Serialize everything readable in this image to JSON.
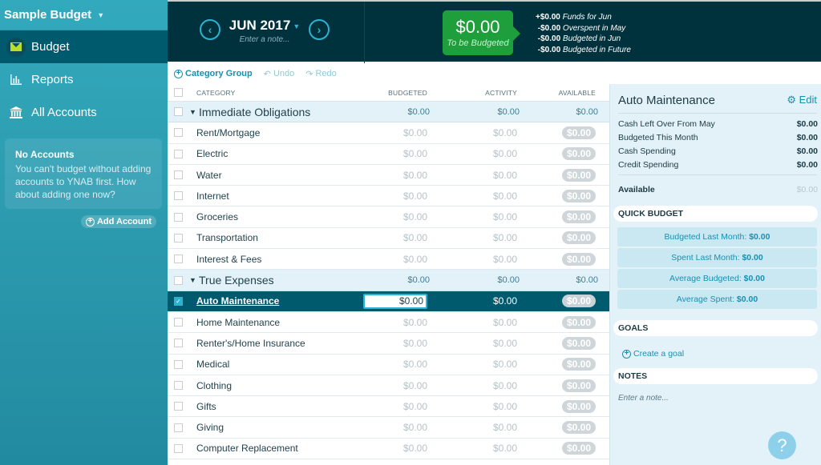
{
  "sidebar": {
    "budget_name": "Sample Budget",
    "nav": [
      {
        "label": "Budget",
        "icon": "envelope-icon",
        "active": true
      },
      {
        "label": "Reports",
        "icon": "bar-chart-icon"
      },
      {
        "label": "All Accounts",
        "icon": "bank-icon"
      }
    ],
    "no_accounts": {
      "title": "No Accounts",
      "text": "You can't budget without adding accounts to YNAB first. How about adding one now?"
    },
    "add_account_label": "Add Account"
  },
  "header": {
    "month": "JUN 2017",
    "note_placeholder": "Enter a note...",
    "to_be_budgeted": {
      "amount": "$0.00",
      "label": "To be Budgeted"
    },
    "funds": [
      {
        "amount": "+$0.00",
        "label": "Funds for Jun"
      },
      {
        "amount": "-$0.00",
        "label": "Overspent in May"
      },
      {
        "amount": "-$0.00",
        "label": "Budgeted in Jun"
      },
      {
        "amount": "-$0.00",
        "label": "Budgeted in Future"
      }
    ]
  },
  "toolbar": {
    "category_group": "Category Group",
    "undo": "Undo",
    "redo": "Redo"
  },
  "table": {
    "headers": {
      "category": "CATEGORY",
      "budgeted": "BUDGETED",
      "activity": "ACTIVITY",
      "available": "AVAILABLE"
    },
    "groups": [
      {
        "name": "Immediate Obligations",
        "budgeted": "$0.00",
        "activity": "$0.00",
        "available": "$0.00",
        "categories": [
          {
            "name": "Rent/Mortgage",
            "budgeted": "$0.00",
            "activity": "$0.00",
            "available": "$0.00"
          },
          {
            "name": "Electric",
            "budgeted": "$0.00",
            "activity": "$0.00",
            "available": "$0.00"
          },
          {
            "name": "Water",
            "budgeted": "$0.00",
            "activity": "$0.00",
            "available": "$0.00"
          },
          {
            "name": "Internet",
            "budgeted": "$0.00",
            "activity": "$0.00",
            "available": "$0.00"
          },
          {
            "name": "Groceries",
            "budgeted": "$0.00",
            "activity": "$0.00",
            "available": "$0.00"
          },
          {
            "name": "Transportation",
            "budgeted": "$0.00",
            "activity": "$0.00",
            "available": "$0.00"
          },
          {
            "name": "Interest & Fees",
            "budgeted": "$0.00",
            "activity": "$0.00",
            "available": "$0.00"
          }
        ]
      },
      {
        "name": "True Expenses",
        "budgeted": "$0.00",
        "activity": "$0.00",
        "available": "$0.00",
        "categories": [
          {
            "name": "Auto Maintenance",
            "budgeted": "$0.00",
            "activity": "$0.00",
            "available": "$0.00",
            "selected": true
          },
          {
            "name": "Home Maintenance",
            "budgeted": "$0.00",
            "activity": "$0.00",
            "available": "$0.00"
          },
          {
            "name": "Renter's/Home Insurance",
            "budgeted": "$0.00",
            "activity": "$0.00",
            "available": "$0.00"
          },
          {
            "name": "Medical",
            "budgeted": "$0.00",
            "activity": "$0.00",
            "available": "$0.00"
          },
          {
            "name": "Clothing",
            "budgeted": "$0.00",
            "activity": "$0.00",
            "available": "$0.00"
          },
          {
            "name": "Gifts",
            "budgeted": "$0.00",
            "activity": "$0.00",
            "available": "$0.00"
          },
          {
            "name": "Giving",
            "budgeted": "$0.00",
            "activity": "$0.00",
            "available": "$0.00"
          },
          {
            "name": "Computer Replacement",
            "budgeted": "$0.00",
            "activity": "$0.00",
            "available": "$0.00"
          }
        ]
      }
    ]
  },
  "inspector": {
    "title": "Auto Maintenance",
    "edit_label": "Edit",
    "rows": [
      {
        "label": "Cash Left Over From May",
        "value": "$0.00"
      },
      {
        "label": "Budgeted This Month",
        "value": "$0.00"
      },
      {
        "label": "Cash Spending",
        "value": "$0.00"
      },
      {
        "label": "Credit Spending",
        "value": "$0.00"
      }
    ],
    "available": {
      "label": "Available",
      "value": "$0.00"
    },
    "quick_budget": {
      "title": "QUICK BUDGET",
      "items": [
        {
          "label": "Budgeted Last Month:",
          "value": "$0.00"
        },
        {
          "label": "Spent Last Month:",
          "value": "$0.00"
        },
        {
          "label": "Average Budgeted:",
          "value": "$0.00"
        },
        {
          "label": "Average Spent:",
          "value": "$0.00"
        }
      ]
    },
    "goals": {
      "title": "GOALS",
      "create_label": "Create a goal"
    },
    "notes": {
      "title": "NOTES",
      "placeholder": "Enter a note..."
    },
    "help_label": "?"
  }
}
